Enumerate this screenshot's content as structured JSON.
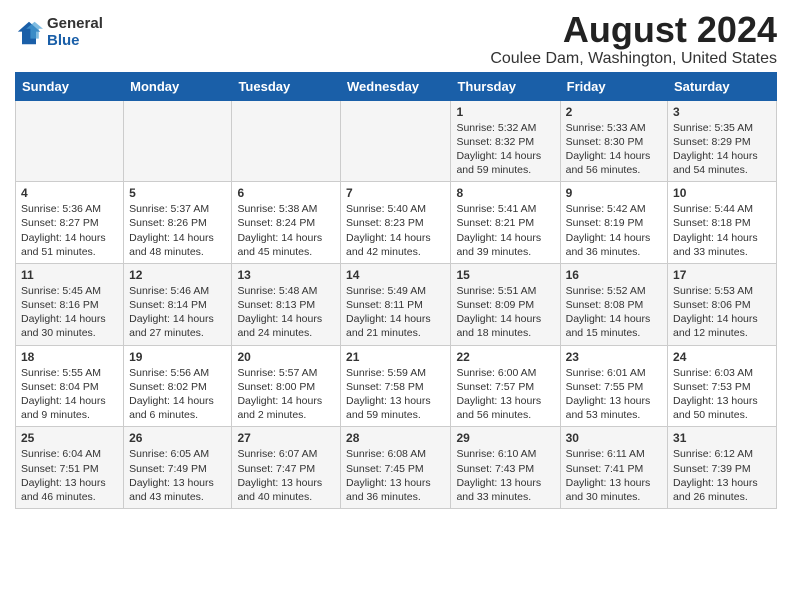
{
  "logo": {
    "general": "General",
    "blue": "Blue"
  },
  "title": "August 2024",
  "location": "Coulee Dam, Washington, United States",
  "days_header": [
    "Sunday",
    "Monday",
    "Tuesday",
    "Wednesday",
    "Thursday",
    "Friday",
    "Saturday"
  ],
  "weeks": [
    [
      {
        "day": "",
        "info": ""
      },
      {
        "day": "",
        "info": ""
      },
      {
        "day": "",
        "info": ""
      },
      {
        "day": "",
        "info": ""
      },
      {
        "day": "1",
        "info": "Sunrise: 5:32 AM\nSunset: 8:32 PM\nDaylight: 14 hours\nand 59 minutes."
      },
      {
        "day": "2",
        "info": "Sunrise: 5:33 AM\nSunset: 8:30 PM\nDaylight: 14 hours\nand 56 minutes."
      },
      {
        "day": "3",
        "info": "Sunrise: 5:35 AM\nSunset: 8:29 PM\nDaylight: 14 hours\nand 54 minutes."
      }
    ],
    [
      {
        "day": "4",
        "info": "Sunrise: 5:36 AM\nSunset: 8:27 PM\nDaylight: 14 hours\nand 51 minutes."
      },
      {
        "day": "5",
        "info": "Sunrise: 5:37 AM\nSunset: 8:26 PM\nDaylight: 14 hours\nand 48 minutes."
      },
      {
        "day": "6",
        "info": "Sunrise: 5:38 AM\nSunset: 8:24 PM\nDaylight: 14 hours\nand 45 minutes."
      },
      {
        "day": "7",
        "info": "Sunrise: 5:40 AM\nSunset: 8:23 PM\nDaylight: 14 hours\nand 42 minutes."
      },
      {
        "day": "8",
        "info": "Sunrise: 5:41 AM\nSunset: 8:21 PM\nDaylight: 14 hours\nand 39 minutes."
      },
      {
        "day": "9",
        "info": "Sunrise: 5:42 AM\nSunset: 8:19 PM\nDaylight: 14 hours\nand 36 minutes."
      },
      {
        "day": "10",
        "info": "Sunrise: 5:44 AM\nSunset: 8:18 PM\nDaylight: 14 hours\nand 33 minutes."
      }
    ],
    [
      {
        "day": "11",
        "info": "Sunrise: 5:45 AM\nSunset: 8:16 PM\nDaylight: 14 hours\nand 30 minutes."
      },
      {
        "day": "12",
        "info": "Sunrise: 5:46 AM\nSunset: 8:14 PM\nDaylight: 14 hours\nand 27 minutes."
      },
      {
        "day": "13",
        "info": "Sunrise: 5:48 AM\nSunset: 8:13 PM\nDaylight: 14 hours\nand 24 minutes."
      },
      {
        "day": "14",
        "info": "Sunrise: 5:49 AM\nSunset: 8:11 PM\nDaylight: 14 hours\nand 21 minutes."
      },
      {
        "day": "15",
        "info": "Sunrise: 5:51 AM\nSunset: 8:09 PM\nDaylight: 14 hours\nand 18 minutes."
      },
      {
        "day": "16",
        "info": "Sunrise: 5:52 AM\nSunset: 8:08 PM\nDaylight: 14 hours\nand 15 minutes."
      },
      {
        "day": "17",
        "info": "Sunrise: 5:53 AM\nSunset: 8:06 PM\nDaylight: 14 hours\nand 12 minutes."
      }
    ],
    [
      {
        "day": "18",
        "info": "Sunrise: 5:55 AM\nSunset: 8:04 PM\nDaylight: 14 hours\nand 9 minutes."
      },
      {
        "day": "19",
        "info": "Sunrise: 5:56 AM\nSunset: 8:02 PM\nDaylight: 14 hours\nand 6 minutes."
      },
      {
        "day": "20",
        "info": "Sunrise: 5:57 AM\nSunset: 8:00 PM\nDaylight: 14 hours\nand 2 minutes."
      },
      {
        "day": "21",
        "info": "Sunrise: 5:59 AM\nSunset: 7:58 PM\nDaylight: 13 hours\nand 59 minutes."
      },
      {
        "day": "22",
        "info": "Sunrise: 6:00 AM\nSunset: 7:57 PM\nDaylight: 13 hours\nand 56 minutes."
      },
      {
        "day": "23",
        "info": "Sunrise: 6:01 AM\nSunset: 7:55 PM\nDaylight: 13 hours\nand 53 minutes."
      },
      {
        "day": "24",
        "info": "Sunrise: 6:03 AM\nSunset: 7:53 PM\nDaylight: 13 hours\nand 50 minutes."
      }
    ],
    [
      {
        "day": "25",
        "info": "Sunrise: 6:04 AM\nSunset: 7:51 PM\nDaylight: 13 hours\nand 46 minutes."
      },
      {
        "day": "26",
        "info": "Sunrise: 6:05 AM\nSunset: 7:49 PM\nDaylight: 13 hours\nand 43 minutes."
      },
      {
        "day": "27",
        "info": "Sunrise: 6:07 AM\nSunset: 7:47 PM\nDaylight: 13 hours\nand 40 minutes."
      },
      {
        "day": "28",
        "info": "Sunrise: 6:08 AM\nSunset: 7:45 PM\nDaylight: 13 hours\nand 36 minutes."
      },
      {
        "day": "29",
        "info": "Sunrise: 6:10 AM\nSunset: 7:43 PM\nDaylight: 13 hours\nand 33 minutes."
      },
      {
        "day": "30",
        "info": "Sunrise: 6:11 AM\nSunset: 7:41 PM\nDaylight: 13 hours\nand 30 minutes."
      },
      {
        "day": "31",
        "info": "Sunrise: 6:12 AM\nSunset: 7:39 PM\nDaylight: 13 hours\nand 26 minutes."
      }
    ]
  ]
}
